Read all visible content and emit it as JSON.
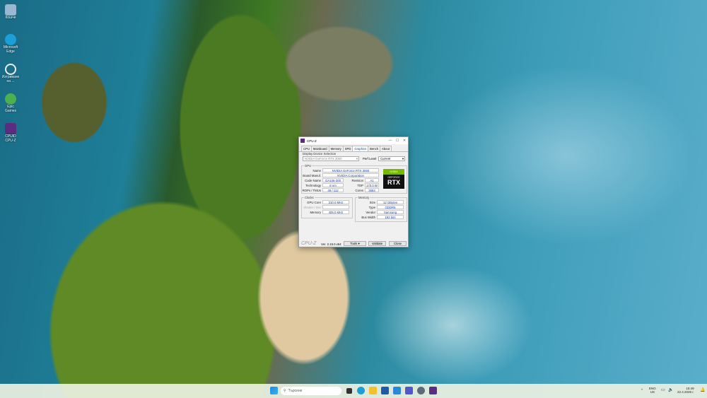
{
  "desktop": {
    "icons": [
      {
        "label": "Кошче",
        "color": "#9ab8d0"
      },
      {
        "label": "Microsoft Edge",
        "color": "#1a9fd8"
      },
      {
        "label": "Изтриване на ...",
        "color": "#3a3a3a"
      },
      {
        "label": "Epic Games",
        "color": "#4caf50"
      },
      {
        "label": "CPUID CPU-Z",
        "color": "#5a2d82"
      }
    ]
  },
  "window": {
    "title": "CPU-Z",
    "tabs": [
      "CPU",
      "Mainboard",
      "Memory",
      "SPD",
      "Graphics",
      "Bench",
      "About"
    ],
    "active_tab": "Graphics",
    "display_selection_label": "Display Device Selection",
    "device": "NVIDIA GeForce RTX 3060",
    "perf_level_label": "Perf Level",
    "perf_level": "Current",
    "gpu": {
      "group": "GPU",
      "name_label": "Name",
      "name": "NVIDIA GeForce RTX 3060",
      "board_label": "Board Manuf.",
      "board": "NVIDIA Corporation",
      "code_label": "Code Name",
      "code": "GA106-300",
      "revision_label": "Revision",
      "revision": "A1",
      "tech_label": "Technology",
      "tech": "8 nm",
      "tdp_label": "TDP",
      "tdp": "170.0 W",
      "rops_label": "ROPs / TMUs",
      "rops": "48 / 112",
      "cores_label": "Cores",
      "cores": "3584",
      "badge_top": "nVIDIA",
      "badge_mid": "GEFORCE",
      "badge_rtx": "RTX"
    },
    "clocks": {
      "group": "Clocks",
      "gpu_label": "GPU Core",
      "gpu": "210.0 MHz",
      "shader_label": "Shader / Sec",
      "memory_label": "Memory",
      "memory": "405.0 MHz"
    },
    "memory": {
      "group": "Memory",
      "size_label": "Size",
      "size": "12 GBytes",
      "type_label": "Type",
      "type": "GDDR6",
      "vendor_label": "Vendor",
      "vendor": "Samsung",
      "bus_label": "Bus Width",
      "bus": "192 bits"
    },
    "footer": {
      "brand": "CPU-Z",
      "version": "Ver. 2.15.0.x64",
      "tools": "Tools",
      "validate": "Validate",
      "close": "Close"
    }
  },
  "taskbar": {
    "search_placeholder": "Търсене",
    "lang_top": "ENG",
    "lang_bottom": "US",
    "time": "15:49",
    "date": "22.4.2026 г."
  }
}
